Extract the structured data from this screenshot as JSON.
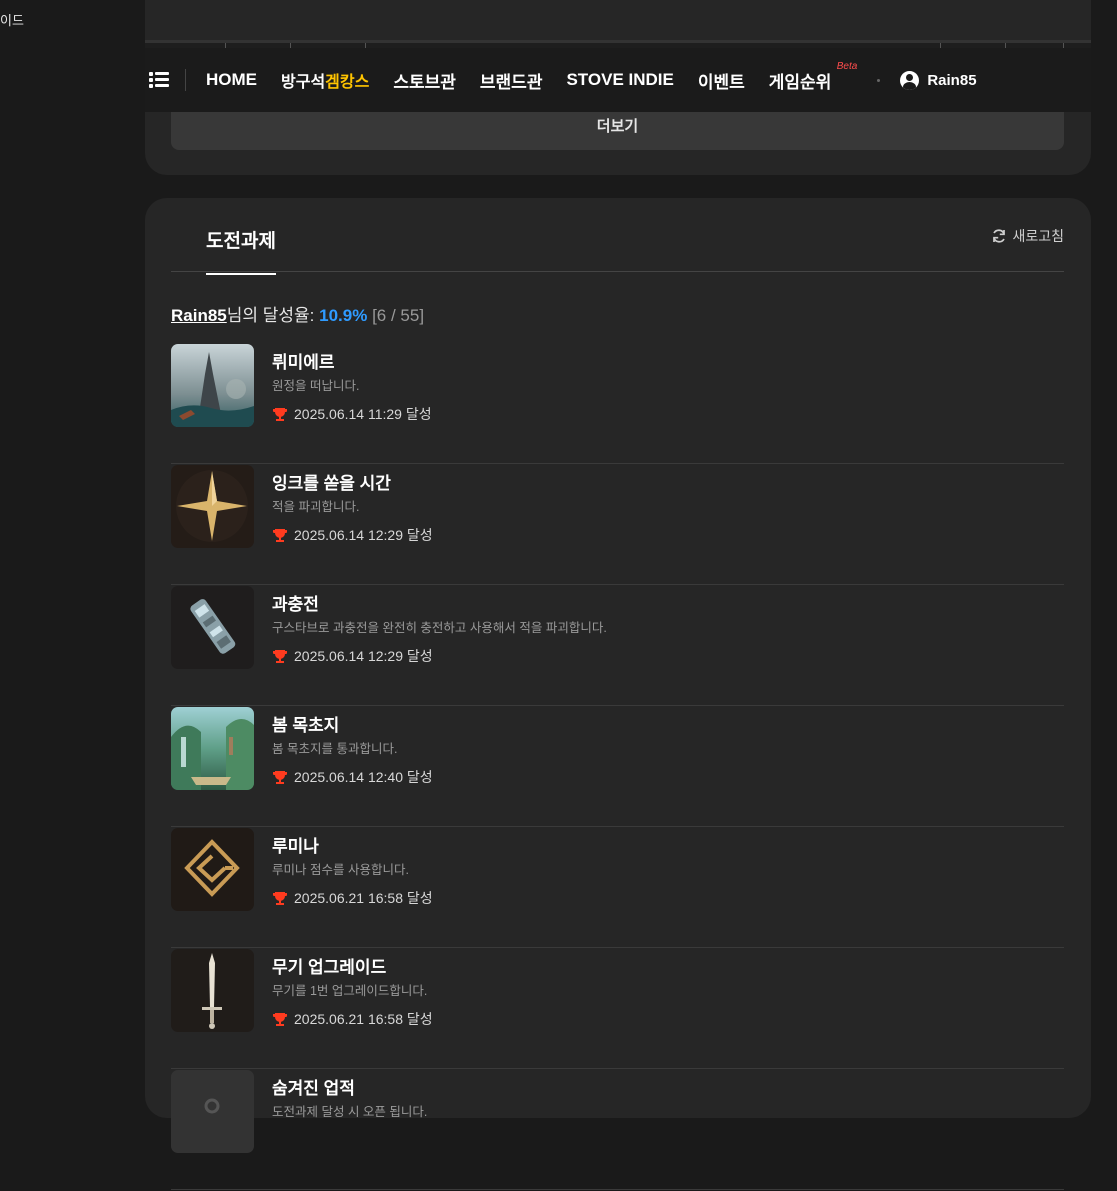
{
  "corner_text": "이드",
  "gnb": {
    "items": [
      "HOME",
      "STOVE INDIE",
      "이벤트"
    ],
    "item_bangu": "방구석",
    "item_gamgangs": "겜캉스",
    "item_store": "스토브관",
    "item_brand": "브랜드관",
    "item_rank": "게임순위",
    "beta": "Beta",
    "username": "Rain85"
  },
  "more_label": "더보기",
  "achievements": {
    "tab_label": "도전과제",
    "refresh_label": "새로고침",
    "user": "Rain85",
    "rate_label": "님의 달성율: ",
    "percent": "10.9%",
    "count": "[6 / 55]",
    "list": [
      {
        "title": "뤼미에르",
        "desc": "원정을 떠납니다.",
        "date": "2025.06.14 11:29 달성",
        "icon": "tower-landscape-image"
      },
      {
        "title": "잉크를 쏟을 시간",
        "desc": "적을 파괴합니다.",
        "date": "2025.06.14 12:29 달성",
        "icon": "gold-star-image"
      },
      {
        "title": "과충전",
        "desc": "구스타브로 과충전을 완전히 충전하고 사용해서 적을 파괴합니다.",
        "date": "2025.06.14 12:29 달성",
        "icon": "mechanical-arm-image"
      },
      {
        "title": "봄 목초지",
        "desc": "봄 목초지를 통과합니다.",
        "date": "2025.06.14 12:40 달성",
        "icon": "spring-meadow-image"
      },
      {
        "title": "루미나",
        "desc": "루미나 점수를 사용합니다.",
        "date": "2025.06.21 16:58 달성",
        "icon": "gold-sigil-image"
      },
      {
        "title": "무기 업그레이드",
        "desc": "무기를 1번 업그레이드합니다.",
        "date": "2025.06.21 16:58 달성",
        "icon": "sword-image"
      },
      {
        "title": "숨겨진 업적",
        "desc": "도전과제 달성 시 오픈 됩니다.",
        "date": "",
        "icon": "locked-image"
      }
    ]
  },
  "colors": {
    "accent_blue": "#2f9bff",
    "accent_yellow": "#ffc400",
    "trophy_red": "#ff3b1f",
    "card_bg": "#262626"
  }
}
